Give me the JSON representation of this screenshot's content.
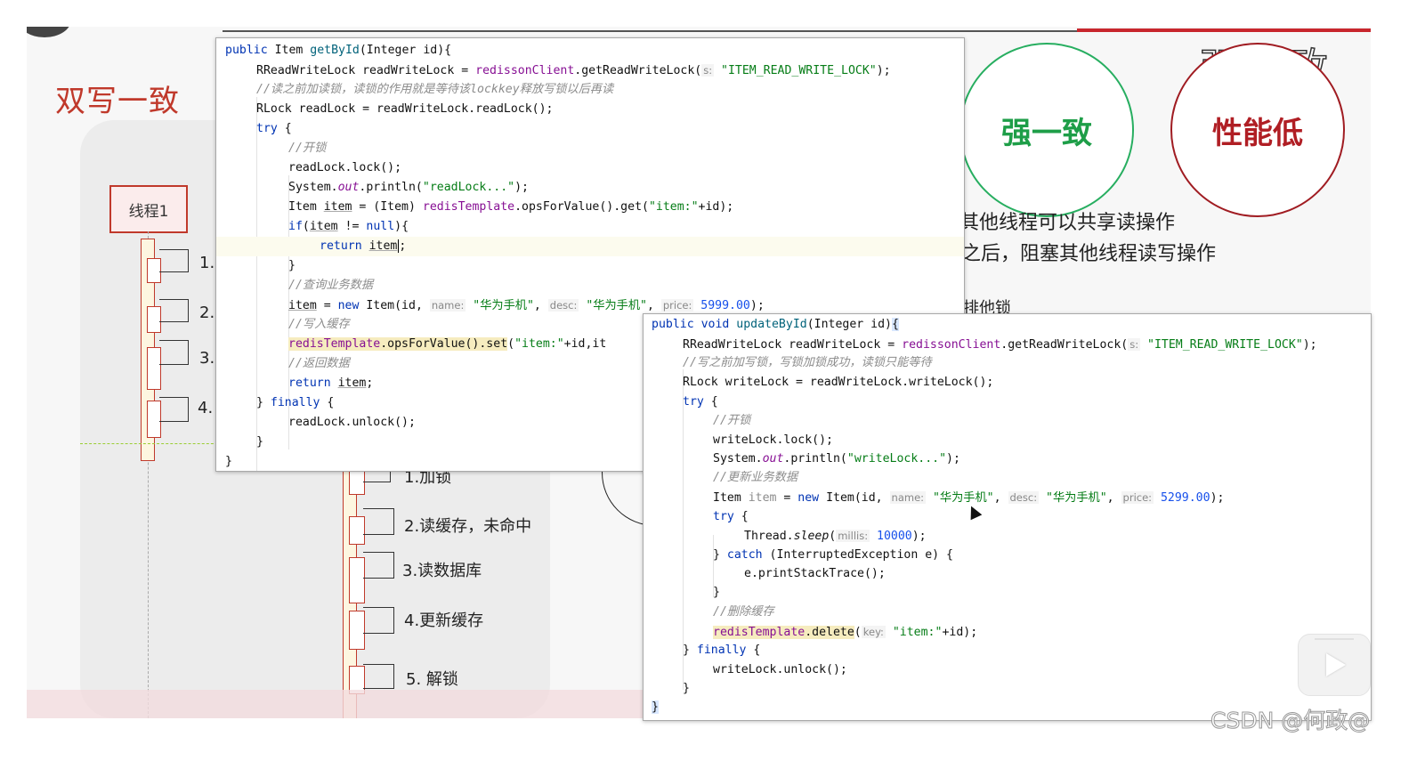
{
  "slide": {
    "title": "双写一致",
    "big_title": "强一致",
    "circle_strong": "强一致",
    "circle_low_perf": "性能低",
    "bg_text_1": "其他线程可以共享读操作",
    "bg_text_2": "之后，阻塞其他线程读写操作",
    "bg_text_3": "排他锁",
    "thread_label": "线程1",
    "steps_left": [
      "1.",
      "2.",
      "3.",
      "4."
    ],
    "steps_right": [
      "1.加锁",
      "2.读缓存，未命中",
      "3.读数据库",
      "4.更新缓存",
      "5. 解锁"
    ]
  },
  "code_read": {
    "l1": {
      "a": "public",
      "b": " Item ",
      "c": "getById",
      "d": "(Integer id){"
    },
    "l2": {
      "a": "RReadWriteLock readWriteLock = ",
      "b": "redissonClient",
      "c": ".getReadWriteLock(",
      "hint": "s:",
      "d": " \"ITEM_READ_WRITE_LOCK\"",
      "e": ");"
    },
    "l3": {
      "a": "//读之前加读锁，读锁的作用就是等待该lockkey释放写锁以后再读"
    },
    "l4": {
      "a": "RLock readLock = readWriteLock.readLock();"
    },
    "l5": {
      "a": "try",
      "b": " {"
    },
    "l6": {
      "a": "//开锁"
    },
    "l7": {
      "a": "readLock.lock();"
    },
    "l8": {
      "a": "System.",
      "b": "out",
      "c": ".println(",
      "d": "\"readLock...\"",
      "e": ");"
    },
    "l9": {
      "a": "Item ",
      "b": "item",
      "c": " = (Item) ",
      "d": "redisTemplate",
      "e": ".opsForValue().get(",
      "f": "\"item:\"",
      "g": "+id);"
    },
    "l10": {
      "a": "if",
      "b": "(",
      "c": "item",
      "d": " != ",
      "e": "null",
      "f": "){"
    },
    "l11": {
      "a": "return",
      "b": " ",
      "c": "item",
      "d": ";"
    },
    "l12": {
      "a": "}"
    },
    "l13": {
      "a": "//查询业务数据"
    },
    "l14": {
      "a": "item",
      "b": " = ",
      "c": "new",
      "d": " Item(id, ",
      "h1": "name:",
      "e": " \"华为手机\"",
      "f": ", ",
      "h2": "desc:",
      "g": " \"华为手机\"",
      "i": ", ",
      "h3": "price:",
      "j": " 5999.00",
      "k": ");"
    },
    "l15": {
      "a": "//写入缓存"
    },
    "l16": {
      "a": "redisTemplate",
      "b": ".opsForValue().set",
      "c": "(",
      "d": "\"item:\"",
      "e": "+id,it"
    },
    "l17": {
      "a": "//返回数据"
    },
    "l18": {
      "a": "return",
      "b": " ",
      "c": "item",
      "d": ";"
    },
    "l19": {
      "a": "} ",
      "b": "finally",
      "c": " {"
    },
    "l20": {
      "a": "readLock.unlock();"
    },
    "l21": {
      "a": "}"
    },
    "l22": {
      "a": "}"
    }
  },
  "code_write": {
    "l1": {
      "a": "public void",
      "b": " ",
      "c": "updateById",
      "d": "(Integer id)",
      "e": "{"
    },
    "l2": {
      "a": "RReadWriteLock readWriteLock = ",
      "b": "redissonClient",
      "c": ".getReadWriteLock(",
      "hint": "s:",
      "d": " \"ITEM_READ_WRITE_LOCK\"",
      "e": ");"
    },
    "l3": {
      "a": "//写之前加写锁，写锁加锁成功，读锁只能等待"
    },
    "l4": {
      "a": "RLock writeLock = readWriteLock.writeLock();"
    },
    "l5": {
      "a": "try",
      "b": " {"
    },
    "l6": {
      "a": "//开锁"
    },
    "l7": {
      "a": "writeLock.lock();"
    },
    "l8": {
      "a": "System.",
      "b": "out",
      "c": ".println(",
      "d": "\"writeLock...\"",
      "e": ");"
    },
    "l9": {
      "a": "//更新业务数据"
    },
    "l10": {
      "a": "Item ",
      "b": "item",
      "c": " = ",
      "d": "new",
      "e": " Item(id, ",
      "h1": "name:",
      "f": " \"华为手机\"",
      "g": ", ",
      "h2": "desc:",
      "i": " \"华为手机\"",
      "j": ", ",
      "h3": "price:",
      "k": " 5299.00",
      "m": ");"
    },
    "l11": {
      "a": "try",
      "b": " {"
    },
    "l12": {
      "a": "Thread.",
      "b": "sleep",
      "c": "(",
      "hint": "millis:",
      "d": " 10000",
      "e": ");"
    },
    "l13": {
      "a": "} ",
      "b": "catch",
      "c": " (InterruptedException e) {"
    },
    "l14": {
      "a": "e.printStackTrace();"
    },
    "l15": {
      "a": "}"
    },
    "l16": {
      "a": "//删除缓存"
    },
    "l17": {
      "a": "redisTemplate",
      "b": ".delete",
      "c": "(",
      "hint": "key:",
      "d": " \"item:\"",
      "e": "+id);"
    },
    "l18": {
      "a": "} ",
      "b": "finally",
      "c": " {"
    },
    "l19": {
      "a": "writeLock.unlock();"
    },
    "l20": {
      "a": "}"
    },
    "l21": {
      "a": "}"
    }
  },
  "watermark": "CSDN @何政@",
  "icons": [
    "play-icon",
    "mouse-cursor-icon"
  ],
  "colors": {
    "accent_red": "#c0392b",
    "accent_green": "#27ae60",
    "keyword": "#0033b3",
    "string": "#067d17",
    "number": "#1750eb"
  }
}
